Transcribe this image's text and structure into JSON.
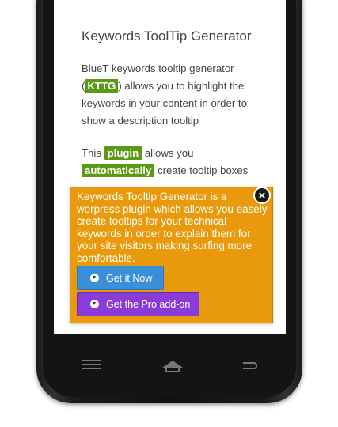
{
  "article": {
    "title": "Keywords ToolTip Generator",
    "para1_a": "BlueT keywords tooltip generator",
    "para1_open": "(",
    "para1_kttg": "KTTG",
    "para1_b": ") allows you to highlight the keywords in your content in order to show a description tooltip",
    "para2_a": "This",
    "para2_plugin": "plugin",
    "para2_b": "allows you",
    "para2_auto": "automatically",
    "para2_c": "create tooltip boxes"
  },
  "tooltip": {
    "text": "Keywords Tooltip Generator is a worpress plugin which allows you easely create tooltips for your technical keywords in order to explain them for your site visitors making surfing more comfortable.",
    "close_icon": "close-icon",
    "free_button": "Get it Now",
    "pro_button": "Get the Pro add-on"
  },
  "colors": {
    "highlight": "#5a9a14",
    "tooltip_bg": "#e89a0c",
    "free_button": "#3a8fd9",
    "pro_button": "#8b3bd8"
  },
  "nav_icons": [
    "menu-icon",
    "home-icon",
    "back-icon"
  ]
}
